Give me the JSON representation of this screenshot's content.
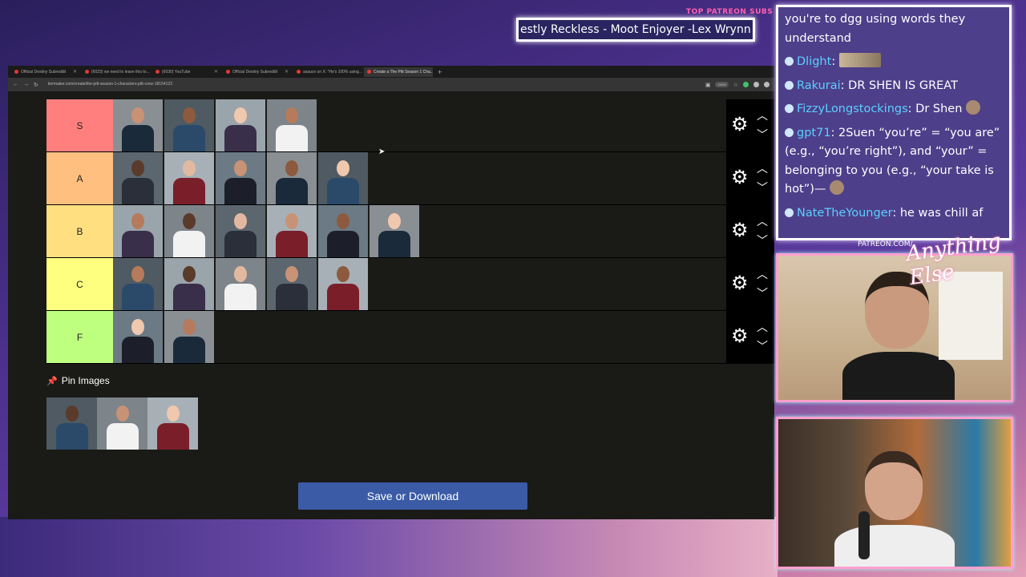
{
  "overlay": {
    "patreon_label": "TOP PATREON SUBS",
    "patreon_scroll": "estly Reckless - Moot Enjoyer -Lex Wrynn -",
    "patreon_logo_label": "PATREON.COM/",
    "logo_text": "Anything Else"
  },
  "browser": {
    "tabs": [
      {
        "label": "Official Destiny Subreddit",
        "active": false
      },
      {
        "label": "(6023) we need to leave this to...",
        "active": false
      },
      {
        "label": "(6030) YouTube",
        "active": false
      },
      {
        "label": "Official Destiny Subreddit",
        "active": false
      },
      {
        "label": "asauce on X: \"He's 100% using...",
        "active": false
      },
      {
        "label": "Create a The Pitt Season 1 Cha...",
        "active": true
      }
    ],
    "url": "tiermaker.com/create/the-pitt-season-1-characters-pitt-crew-18154123",
    "zoom": "210%"
  },
  "tierlist": {
    "tiers": [
      {
        "label": "S",
        "color": "#ff7f7f",
        "count": 4
      },
      {
        "label": "A",
        "color": "#ffbf7f",
        "count": 5
      },
      {
        "label": "B",
        "color": "#ffdf7f",
        "count": 6
      },
      {
        "label": "C",
        "color": "#ffff7f",
        "count": 5
      },
      {
        "label": "F",
        "color": "#bfff7f",
        "count": 2
      }
    ],
    "pin_title": "Pin Images",
    "pin_count": 3,
    "save_button": "Save or Download"
  },
  "chat": {
    "messages": [
      {
        "user": "",
        "text": "you're to dgg using words they understand"
      },
      {
        "user": "Dlight",
        "text": ""
      },
      {
        "user": "Rakurai",
        "text": "DR SHEN IS GREAT"
      },
      {
        "user": "FizzyLongstockings",
        "text": "Dr Shen"
      },
      {
        "user": "gpt71",
        "text": "2Suen “you’re” = “you are” (e.g., “you’re right”), and “your” = belonging to you (e.g., “your take is hot”)—"
      },
      {
        "user": "NateTheYounger",
        "text": "he was chill af"
      }
    ]
  }
}
